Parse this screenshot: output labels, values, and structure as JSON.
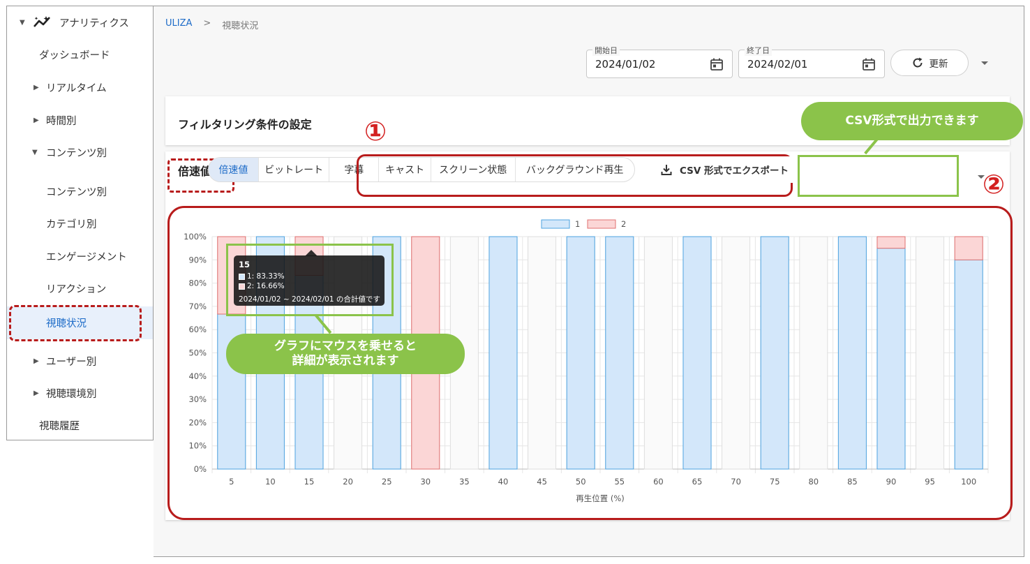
{
  "sidebar": {
    "analytics": "アナリティクス",
    "dashboard": "ダッシュボード",
    "realtime": "リアルタイム",
    "by_time": "時間別",
    "by_content": "コンテンツ別",
    "content": "コンテンツ別",
    "category": "カテゴリ別",
    "engagement": "エンゲージメント",
    "reaction": "リアクション",
    "viewing_status": "視聴状況",
    "by_user": "ユーザー別",
    "by_env": "視聴環境別",
    "history": "視聴履歴"
  },
  "breadcrumb": {
    "home": "ULIZA",
    "sep": ">",
    "current": "視聴状況"
  },
  "dates": {
    "start_label": "開始日",
    "start_value": "2024/01/02",
    "end_label": "終了日",
    "end_value": "2024/02/01"
  },
  "refresh_label": "更新",
  "filter_title": "フィルタリング条件の設定",
  "section_title": "倍速値",
  "help_icon": "?",
  "tabs": [
    "倍速値",
    "ビットレート",
    "字幕",
    "キャスト",
    "スクリーン状態",
    "バックグラウンド再生"
  ],
  "export_label": "CSV 形式でエクスポート",
  "annotations": {
    "num1": "①",
    "num2": "②",
    "csv_callout": "CSV形式で出力できます",
    "hover_callout_line1": "グラフにマウスを乗せると",
    "hover_callout_line2": "詳細が表示されます"
  },
  "tooltip": {
    "title": "15",
    "row1": "1: 83.33%",
    "row2": "2: 16.66%",
    "footer": "2024/01/02 ~ 2024/02/01 の合計値です"
  },
  "colors": {
    "series1": "#d3e7fa",
    "series1_border": "#4ea3e0",
    "series2": "#fbd6d6",
    "series2_border": "#e07070",
    "accent": "#1e6cc8"
  },
  "chart_data": {
    "type": "bar",
    "stacked": true,
    "xlabel": "再生位置 (%)",
    "ylabel": "",
    "ylim": [
      0,
      100
    ],
    "y_ticks": [
      "0%",
      "10%",
      "20%",
      "30%",
      "40%",
      "50%",
      "60%",
      "70%",
      "80%",
      "90%",
      "100%"
    ],
    "categories": [
      "5",
      "10",
      "15",
      "20",
      "25",
      "30",
      "35",
      "40",
      "45",
      "50",
      "55",
      "60",
      "65",
      "70",
      "75",
      "80",
      "85",
      "90",
      "95",
      "100"
    ],
    "series": [
      {
        "name": "1",
        "values": [
          66.67,
          100,
          83.33,
          0,
          100,
          0,
          0,
          100,
          0,
          100,
          100,
          0,
          100,
          0,
          100,
          0,
          100,
          95,
          0,
          90
        ]
      },
      {
        "name": "2",
        "values": [
          33.33,
          0,
          16.66,
          0,
          0,
          100,
          0,
          0,
          0,
          0,
          0,
          0,
          0,
          0,
          0,
          0,
          0,
          5,
          0,
          10
        ]
      }
    ],
    "legend": "top-center",
    "grid": true
  }
}
